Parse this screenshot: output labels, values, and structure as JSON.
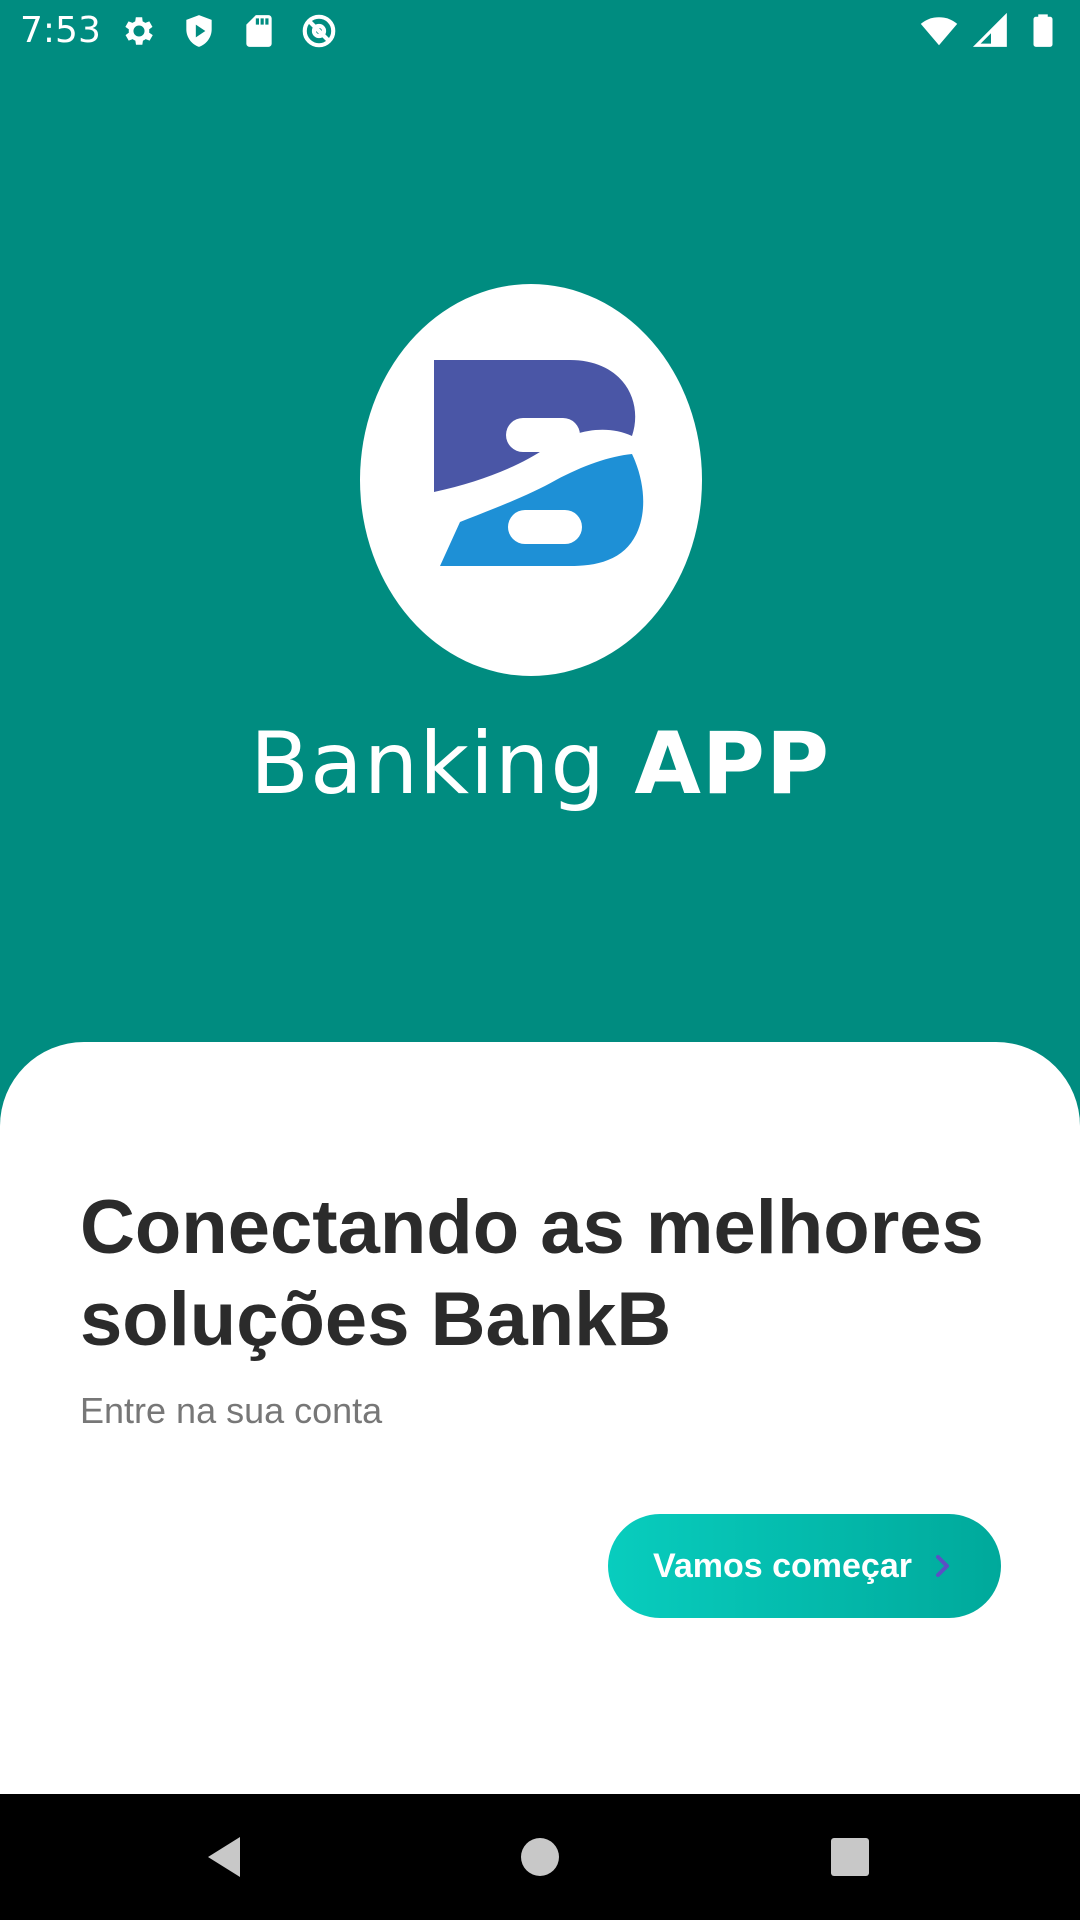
{
  "status_bar": {
    "time": "7:53",
    "left_icons": [
      "settings-icon",
      "play-protect-icon",
      "sd-card-icon",
      "at-sign-icon"
    ],
    "right_icons": [
      "wifi-icon",
      "signal-icon",
      "battery-icon"
    ]
  },
  "brand": {
    "logo_icon": "bankb-logo",
    "name_light": "Banking",
    "name_bold": "APP",
    "colors": {
      "background": "#008C80",
      "logo_top": "#4A56A6",
      "logo_bottom": "#1E90D6"
    }
  },
  "welcome": {
    "headline": "Conectando as melhores soluções BankB",
    "subtitle": "Entre na sua conta",
    "cta_label": "Vamos começar",
    "cta_icon": "chevron-right-icon",
    "colors": {
      "cta_start": "#08CDBE",
      "cta_end": "#00A99B",
      "headline": "#2B2B2B",
      "subtitle": "#777777"
    }
  },
  "nav_bar": {
    "buttons": [
      "back-icon",
      "home-icon",
      "recents-icon"
    ]
  }
}
